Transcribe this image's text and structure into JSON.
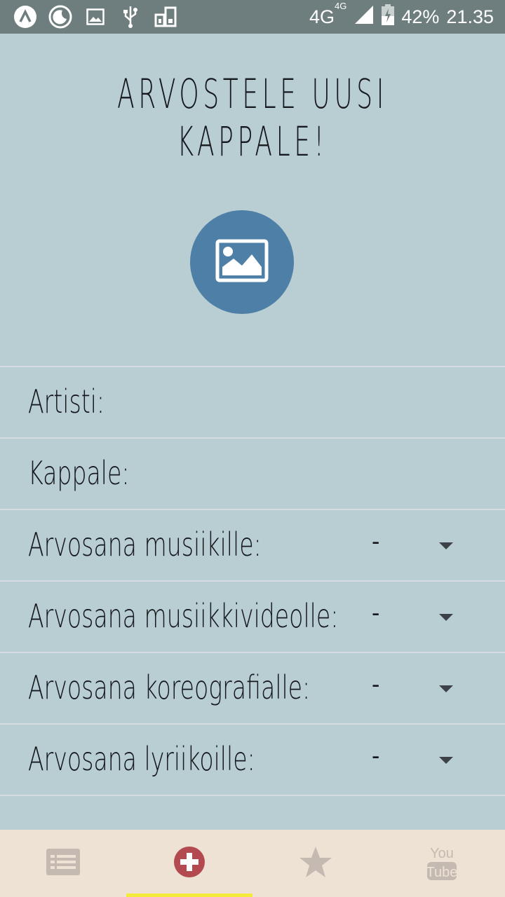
{
  "status_bar": {
    "network": "4G",
    "network_sup": "4G",
    "battery": "42%",
    "time": "21.35",
    "icons": [
      "app-icon",
      "moon-icon",
      "image-icon",
      "usb-icon",
      "sim-icon"
    ]
  },
  "page": {
    "title": "ARVOSTELE UUSI KAPPALE!"
  },
  "form": {
    "artist_label": "Artisti:",
    "song_label": "Kappale:",
    "ratings": [
      {
        "label": "Arvosana musiikille:",
        "value": "-"
      },
      {
        "label": "Arvosana musiikkivideolle:",
        "value": "-"
      },
      {
        "label": "Arvosana koreografialle:",
        "value": "-"
      },
      {
        "label": "Arvosana lyriikoille:",
        "value": "-"
      }
    ]
  },
  "tabs": [
    {
      "icon": "list-icon",
      "active": false
    },
    {
      "icon": "add-icon",
      "active": true
    },
    {
      "icon": "star-icon",
      "active": false
    },
    {
      "icon": "youtube-icon",
      "active": false,
      "text_top": "You",
      "text_bottom": "Tube"
    }
  ],
  "colors": {
    "background": "#b9ced3",
    "status_bar": "#6e7d7d",
    "image_button": "#4e7fa7",
    "tab_bar": "#ede2d4",
    "active_indicator": "#f3ea3c",
    "add_icon": "#b24a4f",
    "inactive_icon": "#c5bab2"
  }
}
